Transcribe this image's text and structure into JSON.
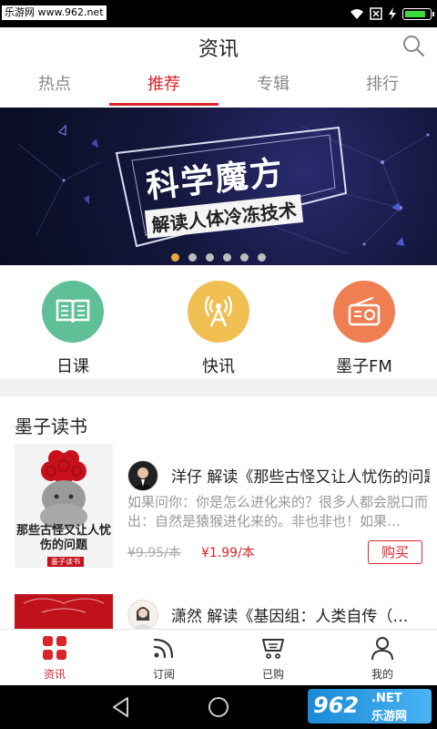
{
  "status_bar": {
    "watermark": "乐游网 www.962.net"
  },
  "header": {
    "title": "资讯"
  },
  "tabs": [
    {
      "label": "热点"
    },
    {
      "label": "推荐"
    },
    {
      "label": "专辑"
    },
    {
      "label": "排行"
    }
  ],
  "banner": {
    "title": "科学魔方",
    "subtitle": "解读人体冷冻技术",
    "slide_count": 6,
    "active_slide": 1
  },
  "quick_links": [
    {
      "label": "日课",
      "color": "#5fbf96",
      "icon": "book-icon"
    },
    {
      "label": "快讯",
      "color": "#f0bf52",
      "icon": "broadcast-icon"
    },
    {
      "label": "墨子FM",
      "color": "#ef7f52",
      "icon": "radio-icon"
    }
  ],
  "section": {
    "title": "墨子读书"
  },
  "books": [
    {
      "title": "洋仔 解读《那些古怪又让人忧伤的问题》",
      "description": "如果问你：你是怎么进化来的？很多人都会脱口而出：自然是猿猴进化来的。非也非也！如果…",
      "old_price": "¥9.95/本",
      "new_price": "¥1.99/本",
      "buy_label": "购买",
      "cover_title": "那些古怪又让人忧伤的问题",
      "cover_tag": "墨子读书"
    },
    {
      "title": "潇然 解读《基因组：人类自传（…",
      "description": "",
      "old_price": "",
      "new_price": "",
      "buy_label": ""
    }
  ],
  "bottom_nav": [
    {
      "label": "资讯",
      "icon": "grid-icon"
    },
    {
      "label": "订阅",
      "icon": "rss-icon"
    },
    {
      "label": "已购",
      "icon": "cart-icon"
    },
    {
      "label": "我的",
      "icon": "user-icon"
    }
  ],
  "system_watermark": {
    "text1": "962",
    "text2": ".NET",
    "text3": "乐游网"
  },
  "colors": {
    "accent": "#d8252c",
    "divider": "#f1f1f1"
  }
}
